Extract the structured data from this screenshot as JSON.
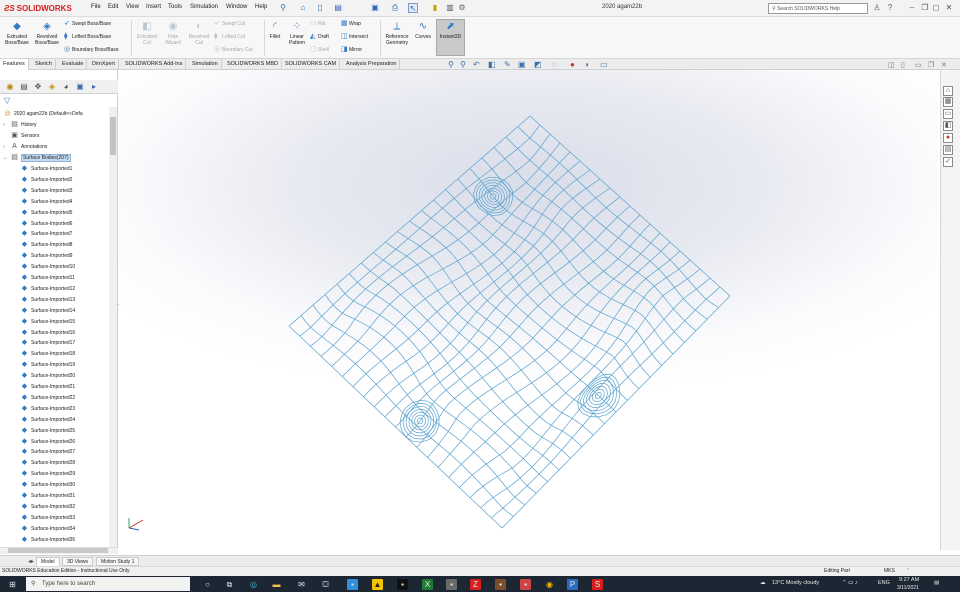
{
  "app": {
    "brand": "SOLIDWORKS",
    "doc_title": "2020 agam22b"
  },
  "menu": [
    "File",
    "Edit",
    "View",
    "Insert",
    "Tools",
    "Simulation",
    "Window",
    "Help"
  ],
  "search": {
    "placeholder": "Search SOLIDWORKS Help"
  },
  "command_manager": {
    "extruded_boss": "Extruded Boss/Base",
    "revolved_boss": "Revolved Boss/Base",
    "swept_boss": "Swept Boss/Base",
    "lofted_boss": "Lofted Boss/Base",
    "boundary_boss": "Boundary Boss/Base",
    "extruded_cut": "Extruded Cut",
    "hole_wizard": "Hole Wizard",
    "revolved_cut": "Revolved Cut",
    "swept_cut": "Swept Cut",
    "lofted_cut": "Lofted Cut",
    "boundary_cut": "Boundary Cut",
    "fillet": "Fillet",
    "linear_pattern": "Linear Pattern",
    "rib": "Rib",
    "draft": "Draft",
    "shell": "Shell",
    "wrap": "Wrap",
    "intersect": "Intersect",
    "mirror": "Mirror",
    "reference_geometry": "Reference Geometry",
    "curves": "Curves",
    "instant3d": "Instant3D"
  },
  "tabs": [
    "Features",
    "Sketch",
    "Evaluate",
    "DimXpert",
    "SOLIDWORKS Add-Ins",
    "Simulation",
    "SOLIDWORKS MBD",
    "SOLIDWORKS CAM",
    "Analysis Preparation"
  ],
  "active_tab": "Features",
  "tree": {
    "root": "2020 agam22b (Default<<Defa",
    "history": "History",
    "sensors": "Sensors",
    "annotations": "Annotations",
    "surface_bodies": "Surface Bodies(207)",
    "items": [
      "Surface-Imported1",
      "Surface-Imported2",
      "Surface-Imported3",
      "Surface-Imported4",
      "Surface-Imported5",
      "Surface-Imported6",
      "Surface-Imported7",
      "Surface-Imported8",
      "Surface-Imported9",
      "Surface-Imported10",
      "Surface-Imported11",
      "Surface-Imported12",
      "Surface-Imported13",
      "Surface-Imported14",
      "Surface-Imported15",
      "Surface-Imported16",
      "Surface-Imported17",
      "Surface-Imported18",
      "Surface-Imported19",
      "Surface-Imported20",
      "Surface-Imported21",
      "Surface-Imported22",
      "Surface-Imported23",
      "Surface-Imported24",
      "Surface-Imported25",
      "Surface-Imported26",
      "Surface-Imported27",
      "Surface-Imported28",
      "Surface-Imported29",
      "Surface-Imported30",
      "Surface-Imported31",
      "Surface-Imported32",
      "Surface-Imported33",
      "Surface-Imported34",
      "Surface-Imported35"
    ]
  },
  "bottom_tabs": [
    "Model",
    "3D Views",
    "Motion Study 1"
  ],
  "status": {
    "edition": "SOLIDWORKS Education Edition - Instructional Use Only",
    "mode": "Editing Part",
    "units": "MKS"
  },
  "taskbar": {
    "search_placeholder": "Type here to search",
    "weather": "13°C  Mostly cloudy",
    "lang": "ENG",
    "time": "9:27 AM",
    "date": "3/11/2021"
  },
  "colors": {
    "mesh": "#5aa3cf",
    "brand": "#d6201f",
    "taskbar": "#1d2733"
  }
}
